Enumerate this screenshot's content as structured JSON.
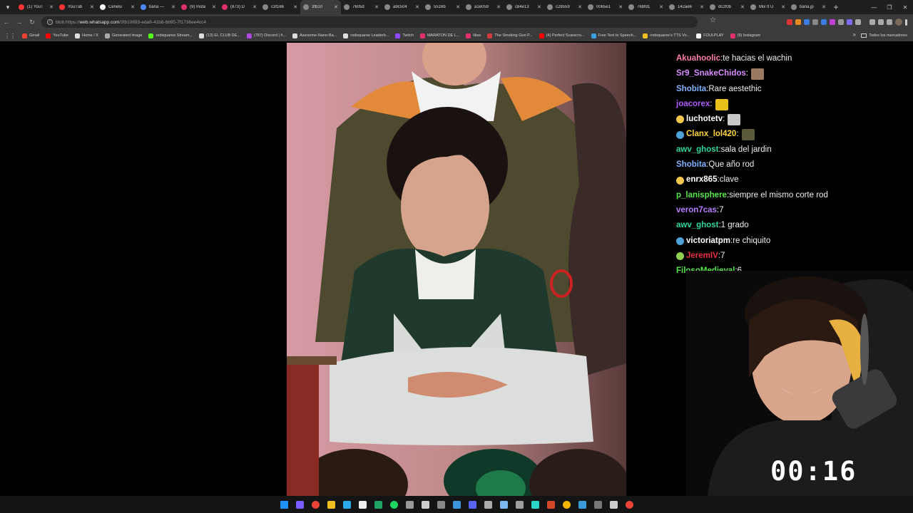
{
  "browser": {
    "tabs": [
      {
        "title": "(1) YouT",
        "color": "#ff3333"
      },
      {
        "title": "YouTub",
        "color": "#ff3333"
      },
      {
        "title": "Cenelu",
        "color": "#ffffff"
      },
      {
        "title": "bana —",
        "color": "#4a8af4"
      },
      {
        "title": "(9) Insta",
        "color": "#e1306c"
      },
      {
        "title": "(873) D",
        "color": "#e1306c"
      },
      {
        "title": "c3f166",
        "color": "#888888"
      },
      {
        "title": "3fb10",
        "color": "#888888",
        "active": true
      },
      {
        "title": "7605d",
        "color": "#888888"
      },
      {
        "title": "a9c504",
        "color": "#888888"
      },
      {
        "title": "5516b",
        "color": "#888888"
      },
      {
        "title": "a1e059",
        "color": "#888888"
      },
      {
        "title": "c84e13",
        "color": "#888888"
      },
      {
        "title": "c28559",
        "color": "#888888"
      },
      {
        "title": "0065e1",
        "color": "#888888"
      },
      {
        "title": "76bfd1",
        "color": "#888888"
      },
      {
        "title": "142ae6",
        "color": "#888888"
      },
      {
        "title": "dc2f0b",
        "color": "#888888"
      },
      {
        "title": "Mix It U",
        "color": "#888888"
      },
      {
        "title": "bana.jp",
        "color": "#888888"
      }
    ],
    "url_prefix": "blob:https://",
    "url_host": "web.whatsapp.com",
    "url_path": "/3fb10693-eda9-41b8-bb95-7f1736ee4cc4",
    "bookmarks": [
      {
        "label": "Gmail",
        "color": "#ea4335"
      },
      {
        "label": "YouTube",
        "color": "#ff0000"
      },
      {
        "label": "Home / X",
        "color": "#dddddd"
      },
      {
        "label": "Generated image",
        "color": "#aaaaaa"
      },
      {
        "label": "rodsquaree Stream...",
        "color": "#53fc18"
      },
      {
        "label": "(13) EL CLUB DE...",
        "color": "#dddddd"
      },
      {
        "label": "(787) Discord | #...",
        "color": "#b048e8"
      },
      {
        "label": "Awesome-Nano-Ba...",
        "color": "#dddddd"
      },
      {
        "label": "rodsquaree Leaderb...",
        "color": "#dddddd"
      },
      {
        "label": "Twitch",
        "color": "#9146ff"
      },
      {
        "label": "MARATON DE L...",
        "color": "#e1306c"
      },
      {
        "label": "likes",
        "color": "#e1306c"
      },
      {
        "label": "The Smoking Gun P...",
        "color": "#d43b3b"
      },
      {
        "label": "(4) Perfect Scarecro...",
        "color": "#ff0000"
      },
      {
        "label": "Free Text to Speech...",
        "color": "#3aa0e0"
      },
      {
        "label": "rodsquaree's TTS Vo...",
        "color": "#f0c020"
      },
      {
        "label": "FOULPLAY",
        "color": "#ffffff"
      },
      {
        "label": "(9) Instagram",
        "color": "#e1306c"
      }
    ],
    "all_bookmarks_label": "Todos los marcadores"
  },
  "chat": {
    "messages": [
      {
        "user": "Akuahoolic",
        "text": " te hacias el wachin",
        "color": "#ff7fa8"
      },
      {
        "user": "Sr9_SnakeChidos",
        "text": "",
        "color": "#d98cff",
        "emote": "#9a7a62"
      },
      {
        "user": "Shobita",
        "text": " Rare aestethic",
        "color": "#7fb3ff"
      },
      {
        "user": "joacorex",
        "text": "",
        "color": "#b05cff",
        "emote": "#e8c01c"
      },
      {
        "user": "luchotetv",
        "text": "",
        "color": "#ffffff",
        "badge": "#f2c94c",
        "emote": "#c8c8c8"
      },
      {
        "user": "Clanx_lol420",
        "text": "",
        "color": "#ffd33d",
        "badge": "#4fa3d6",
        "emote": "#5a5a3a"
      },
      {
        "user": "awv_ghost",
        "text": " sala del jardin",
        "color": "#2fd6a0"
      },
      {
        "user": "Shobita",
        "text": " Que año rod",
        "color": "#7fb3ff"
      },
      {
        "user": "enrx865",
        "text": " clave",
        "color": "#ffffff",
        "badge": "#f2c94c"
      },
      {
        "user": "p_lanisphere",
        "text": " siempre el mismo corte rod",
        "color": "#57e64a"
      },
      {
        "user": "veron7cas",
        "text": " 7",
        "color": "#b77dff"
      },
      {
        "user": "awv_ghost",
        "text": " 1 grado",
        "color": "#2fd6a0"
      },
      {
        "user": "victoriatpm",
        "text": " re chiquito",
        "color": "#ffffff",
        "badge": "#4fa3d6"
      },
      {
        "user": "JeremIV",
        "text": " 7",
        "color": "#e8323c",
        "badge": "#8fd14f"
      },
      {
        "user": "FilosoMedieval",
        "text": " 6",
        "color": "#57e64a"
      }
    ]
  },
  "stream": {
    "timer": "00:16"
  },
  "taskbar": {
    "icons": [
      "windows-icon",
      "copilot-icon",
      "chrome-icon",
      "explorer-icon",
      "telegram-icon",
      "obs-icon",
      "excel-icon",
      "spotify-icon",
      "camera-icon",
      "play-icon",
      "settings-icon",
      "vscode-icon",
      "discord-icon",
      "vpn-icon",
      "notepad-icon",
      "audio-icon",
      "browser2-icon",
      "ppt-icon",
      "chrome-dev-icon",
      "photos-icon",
      "tool-icon",
      "terminal-icon",
      "chrome2-icon"
    ],
    "colors": [
      "#1e90ff",
      "#7b5cff",
      "#ea4335",
      "#f0c020",
      "#29a9eb",
      "#eeeeee",
      "#21a366",
      "#1ed760",
      "#999999",
      "#cccccc",
      "#888888",
      "#3a96dd",
      "#5865f2",
      "#aaaaaa",
      "#7fb8f0",
      "#9e9e9e",
      "#2ad4c9",
      "#d24726",
      "#f4b400",
      "#3a9ad9",
      "#777777",
      "#cccccc",
      "#ea4335"
    ]
  }
}
